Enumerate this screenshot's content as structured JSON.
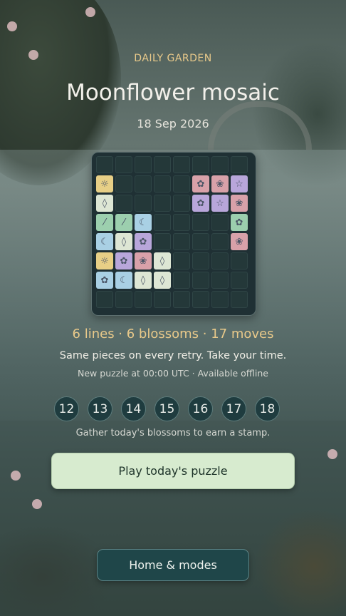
{
  "header": {
    "eyebrow": "DAILY GARDEN",
    "title": "Moonflower mosaic",
    "date": "18 Sep 2026"
  },
  "board": {
    "rows": 8,
    "cols": 8,
    "pieces": [
      {
        "row": 1,
        "col": 0,
        "color": "#e7cf86",
        "icon": "sun-icon",
        "glyph": "☼"
      },
      {
        "row": 1,
        "col": 5,
        "color": "#d8a1a9",
        "icon": "blossom-icon",
        "glyph": "✿"
      },
      {
        "row": 1,
        "col": 6,
        "color": "#d8a1a9",
        "icon": "flower-icon",
        "glyph": "❀"
      },
      {
        "row": 1,
        "col": 7,
        "color": "#b8a6da",
        "icon": "star-icon",
        "glyph": "☆"
      },
      {
        "row": 2,
        "col": 0,
        "color": "#dde6d4",
        "icon": "drop-icon",
        "glyph": "◊"
      },
      {
        "row": 2,
        "col": 5,
        "color": "#b8a6da",
        "icon": "blossom-icon",
        "glyph": "✿"
      },
      {
        "row": 2,
        "col": 6,
        "color": "#b8a6da",
        "icon": "star-icon",
        "glyph": "☆"
      },
      {
        "row": 2,
        "col": 7,
        "color": "#d8a1a9",
        "icon": "flower-icon",
        "glyph": "❀"
      },
      {
        "row": 3,
        "col": 0,
        "color": "#9ccfae",
        "icon": "leaf-icon",
        "glyph": "⁄"
      },
      {
        "row": 3,
        "col": 1,
        "color": "#9ccfae",
        "icon": "leaf-icon",
        "glyph": "⁄"
      },
      {
        "row": 3,
        "col": 2,
        "color": "#a9d0e4",
        "icon": "moon-icon",
        "glyph": "☾"
      },
      {
        "row": 3,
        "col": 7,
        "color": "#9ccfae",
        "icon": "blossom-icon",
        "glyph": "✿"
      },
      {
        "row": 4,
        "col": 0,
        "color": "#a9d0e4",
        "icon": "moon-icon",
        "glyph": "☾"
      },
      {
        "row": 4,
        "col": 1,
        "color": "#dde6d4",
        "icon": "drop-icon",
        "glyph": "◊"
      },
      {
        "row": 4,
        "col": 2,
        "color": "#b8a6da",
        "icon": "blossom-icon",
        "glyph": "✿"
      },
      {
        "row": 4,
        "col": 7,
        "color": "#d8a1a9",
        "icon": "flower-icon",
        "glyph": "❀"
      },
      {
        "row": 5,
        "col": 0,
        "color": "#e7cf86",
        "icon": "sun-icon",
        "glyph": "☼"
      },
      {
        "row": 5,
        "col": 1,
        "color": "#b8a6da",
        "icon": "blossom-icon",
        "glyph": "✿"
      },
      {
        "row": 5,
        "col": 2,
        "color": "#d8a1a9",
        "icon": "flower-icon",
        "glyph": "❀"
      },
      {
        "row": 5,
        "col": 3,
        "color": "#dde6d4",
        "icon": "drop-icon",
        "glyph": "◊"
      },
      {
        "row": 6,
        "col": 0,
        "color": "#a9d0e4",
        "icon": "blossom-icon",
        "glyph": "✿"
      },
      {
        "row": 6,
        "col": 1,
        "color": "#a9d0e4",
        "icon": "moon-icon",
        "glyph": "☾"
      },
      {
        "row": 6,
        "col": 2,
        "color": "#dde6d4",
        "icon": "drop-icon",
        "glyph": "◊"
      },
      {
        "row": 6,
        "col": 3,
        "color": "#dde6d4",
        "icon": "drop-icon",
        "glyph": "◊"
      }
    ]
  },
  "stats": "6 lines · 6 blossoms · 17 moves",
  "info": {
    "line1": "Same pieces on every retry. Take your time.",
    "line2": "New puzzle at 00:00 UTC · Available offline"
  },
  "days": [
    "12",
    "13",
    "14",
    "15",
    "16",
    "17",
    "18"
  ],
  "hint": "Gather today's blossoms to earn a stamp.",
  "buttons": {
    "play": "Play today's puzzle",
    "home": "Home & modes"
  },
  "colors": {
    "accent": "#e8c98a",
    "play_bg": "#d7ebcf",
    "home_bg": "#1f4649",
    "board_bg": "#1f3034"
  }
}
